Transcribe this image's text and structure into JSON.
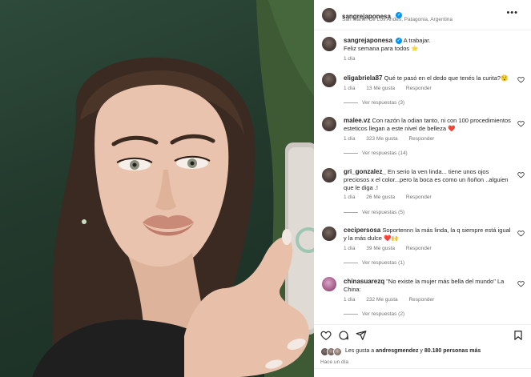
{
  "header": {
    "username": "sangrejaponesa",
    "location": "San Martín De Los Andes, Patagonia, Argentina",
    "more_icon": "more-horizontal-icon"
  },
  "caption": {
    "username": "sangrejaponesa",
    "text_line1": "A trabajar.",
    "text_line2": "Feliz semana para todos ⭐",
    "time": "1 día"
  },
  "comments": [
    {
      "username": "eligabriela87",
      "text": "Qué te pasó en el dedo que tenés la curita?😯",
      "time": "1 día",
      "likes": "13 Me gusta",
      "reply": "Responder",
      "replies": "Ver respuestas (3)"
    },
    {
      "username": "malee.vz",
      "text": "Con razón la odian tanto, ni con 100 procedimientos esteticos llegan a este nivel de belleza ❤️",
      "time": "1 día",
      "likes": "323 Me gusta",
      "reply": "Responder",
      "replies": "Ver respuestas (14)"
    },
    {
      "username": "gri_gonzalez_",
      "text": "En serio la ven linda... tiene unos ojos preciosos x el color...pero la boca es como un ñoñon ..alguien que le diga .!",
      "time": "1 día",
      "likes": "26 Me gusta",
      "reply": "Responder",
      "replies": "Ver respuestas (5)"
    },
    {
      "username": "cecipersosa",
      "text": "Soportennn la más linda, la q siempre está igual y la más dulce ❤️🙌",
      "time": "1 día",
      "likes": "39 Me gusta",
      "reply": "Responder",
      "replies": "Ver respuestas (1)"
    },
    {
      "username": "chinasuarezq",
      "text": "\"No existe la mujer más bella del mundo\" La China:",
      "time": "1 día",
      "likes": "232 Me gusta",
      "reply": "Responder",
      "replies": "Ver respuestas (2)"
    }
  ],
  "likes": {
    "prefix": "Les gusta a",
    "user": "andresgmendez",
    "suffix": "y",
    "count": "80.180 personas más"
  },
  "posted": "Hace un día",
  "colors": {
    "verified": "#0095f6",
    "muted": "#737373",
    "text": "#262626",
    "wall": "#2e4a3a"
  }
}
